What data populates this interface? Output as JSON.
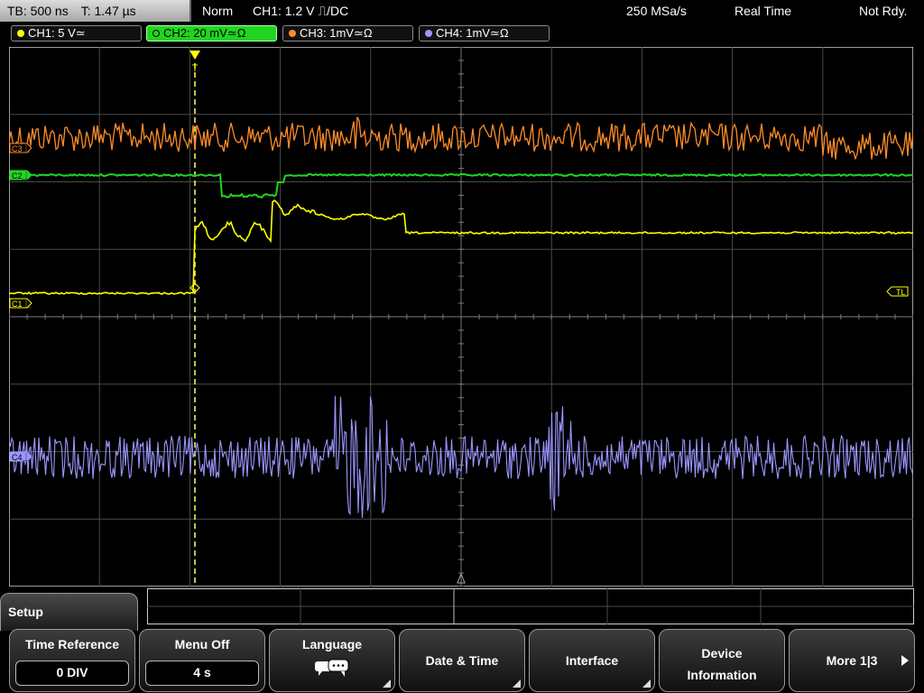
{
  "top_bar": {
    "timebase": "TB: 500 ns",
    "trigger_time": "T: 1.47 µs",
    "trigger_mode": "Norm",
    "trigger_source": "CH1: 1.2 V ⎍/DC",
    "sample_rate": "250 MSa/s",
    "acquisition_mode": "Real Time",
    "status": "Not Rdy."
  },
  "channels": [
    {
      "label": "CH1: 5 V≃",
      "color": "#ffff00"
    },
    {
      "label": "CH2: 20 mV≃Ω",
      "color": "#22d422",
      "active": true
    },
    {
      "label": "CH3: 1mV≃Ω",
      "color": "#ff8c28"
    },
    {
      "label": "CH4: 1mV≃Ω",
      "color": "#9a96ff"
    }
  ],
  "markers": {
    "c3": "C3⏊",
    "c2": "C2⏊",
    "c1": "C1⏊",
    "c4": "C4⏊",
    "trigger_level": "TL",
    "trigger_pos": "T"
  },
  "menu": {
    "title": "Setup",
    "softkeys": [
      {
        "label": "Time Reference",
        "value": "0 DIV"
      },
      {
        "label": "Menu Off",
        "value": "4 s"
      },
      {
        "label": "Language",
        "icon": "speech-bubbles-icon"
      },
      {
        "label": "Date & Time"
      },
      {
        "label": "Interface"
      },
      {
        "label": "Device Information"
      },
      {
        "label": "More 1|3"
      }
    ]
  }
}
